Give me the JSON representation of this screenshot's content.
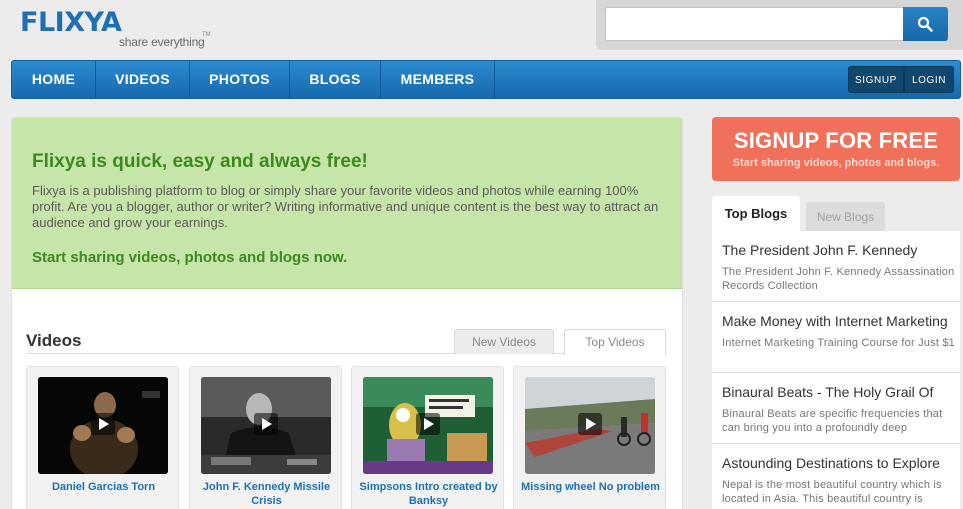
{
  "brand": {
    "name": "FLIXYA",
    "tagline": "share everything",
    "trademark": "TM"
  },
  "search": {
    "value": "",
    "placeholder": ""
  },
  "nav": {
    "items": [
      "HOME",
      "VIDEOS",
      "PHOTOS",
      "BLOGS",
      "MEMBERS"
    ],
    "signup": "SIGNUP",
    "login": "LOGIN"
  },
  "hero": {
    "title": "Flixya is quick, easy and always free!",
    "text": "Flixya is a publishing platform to blog or simply share your favorite videos and photos while earning 100% profit. Are you a blogger, author or writer? Writing informative and unique content is the best way to attract an audience and grow your earnings.",
    "cta": "Start sharing videos, photos and blogs now."
  },
  "videos": {
    "title": "Videos",
    "tabs": [
      "New Videos",
      "Top Videos"
    ],
    "active_tab": "Top Videos",
    "items": [
      {
        "title": "Daniel Garcias Torn"
      },
      {
        "title": "John F. Kennedy Missile Crisis"
      },
      {
        "title": "Simpsons Intro created by Banksy"
      },
      {
        "title": "Missing wheel No problem"
      }
    ]
  },
  "signup_promo": {
    "title": "SIGNUP FOR FREE",
    "subtitle": "Start sharing videos, photos and blogs."
  },
  "blogs": {
    "tabs": [
      "Top Blogs",
      "New Blogs"
    ],
    "active_tab": "Top Blogs",
    "items": [
      {
        "title": "The President John F. Kennedy",
        "desc": "The President John F. Kennedy Assassination Records Collection"
      },
      {
        "title": "Make Money with Internet Marketing",
        "desc": "Internet Marketing Training Course for Just $1"
      },
      {
        "title": "Binaural Beats - The Holy Grail Of",
        "desc": "Binaural Beats are specific frequencies that can bring you into a profoundly deep"
      },
      {
        "title": "Astounding Destinations to Explore",
        "desc": "Nepal is the most beautiful country which is located in Asia. This beautiful country is"
      }
    ]
  },
  "colors": {
    "brand_blue": "#1e6fb5",
    "nav_blue": "#1769ac",
    "hero_green": "#c6e5a9",
    "hero_text_green": "#3d8a1c",
    "signup_coral": "#f0705a",
    "link_blue": "#1d6fb6"
  }
}
